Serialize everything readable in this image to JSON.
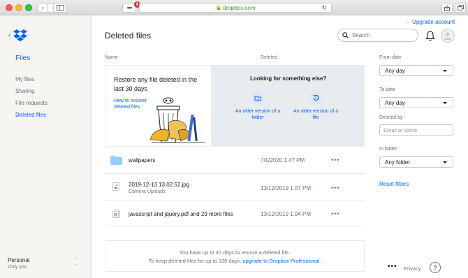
{
  "browser": {
    "url": "dropbox.com",
    "badge_count": "9",
    "ext_label": "•••"
  },
  "sidebar": {
    "section_title": "Files",
    "items": [
      {
        "label": "My files"
      },
      {
        "label": "Sharing"
      },
      {
        "label": "File requests"
      },
      {
        "label": "Deleted files",
        "active": true
      }
    ],
    "account_name": "Personal",
    "account_sub": "Only you"
  },
  "header": {
    "title": "Deleted files",
    "upgrade_label": "Upgrade account",
    "search_placeholder": "Search"
  },
  "table": {
    "col_name": "Name",
    "col_deleted": "Deleted"
  },
  "banner": {
    "restore_text": "Restore any file deleted in the last 30 days",
    "recover_link": "How to recover deleted files",
    "looking_title": "Looking for something else?",
    "option_folder": "An older version of a folder",
    "option_file": "An older version of a file"
  },
  "files": [
    {
      "name": "wallpapers",
      "sub": "",
      "deleted": "7/1/2020 1:47 PM",
      "icon": "folder-icon"
    },
    {
      "name": "2019-12-13 13.02.52.jpg",
      "sub": "Camera Uploads",
      "deleted": "13/12/2019 1:07 PM",
      "icon": "image-file-icon"
    },
    {
      "name": "javascript and jquery.pdf and 29 more files",
      "sub": "",
      "deleted": "13/12/2019 1:04 PM",
      "icon": "multiple-files-icon"
    }
  ],
  "note": {
    "line1": "You have up to 30 days to restore a deleted file.",
    "line2_prefix": "To keep deleted files for up to 120 days,",
    "line2_link": "upgrade to Dropbox Professional",
    "line2_suffix": "."
  },
  "filters": {
    "from_label": "From date",
    "from_value": "Any day",
    "to_label": "To date",
    "to_value": "Any day",
    "deleted_by_label": "Deleted by",
    "deleted_by_placeholder": "Email or name",
    "in_folder_label": "In folder",
    "in_folder_value": "Any folder",
    "reset_label": "Reset filters"
  },
  "footer": {
    "more_label": "•••",
    "privacy_label": "Privacy",
    "help_label": "?"
  },
  "colors": {
    "accent": "#0061fe",
    "sidebar_bg": "#f7f5f2",
    "banner_bg": "#e9ecef"
  }
}
